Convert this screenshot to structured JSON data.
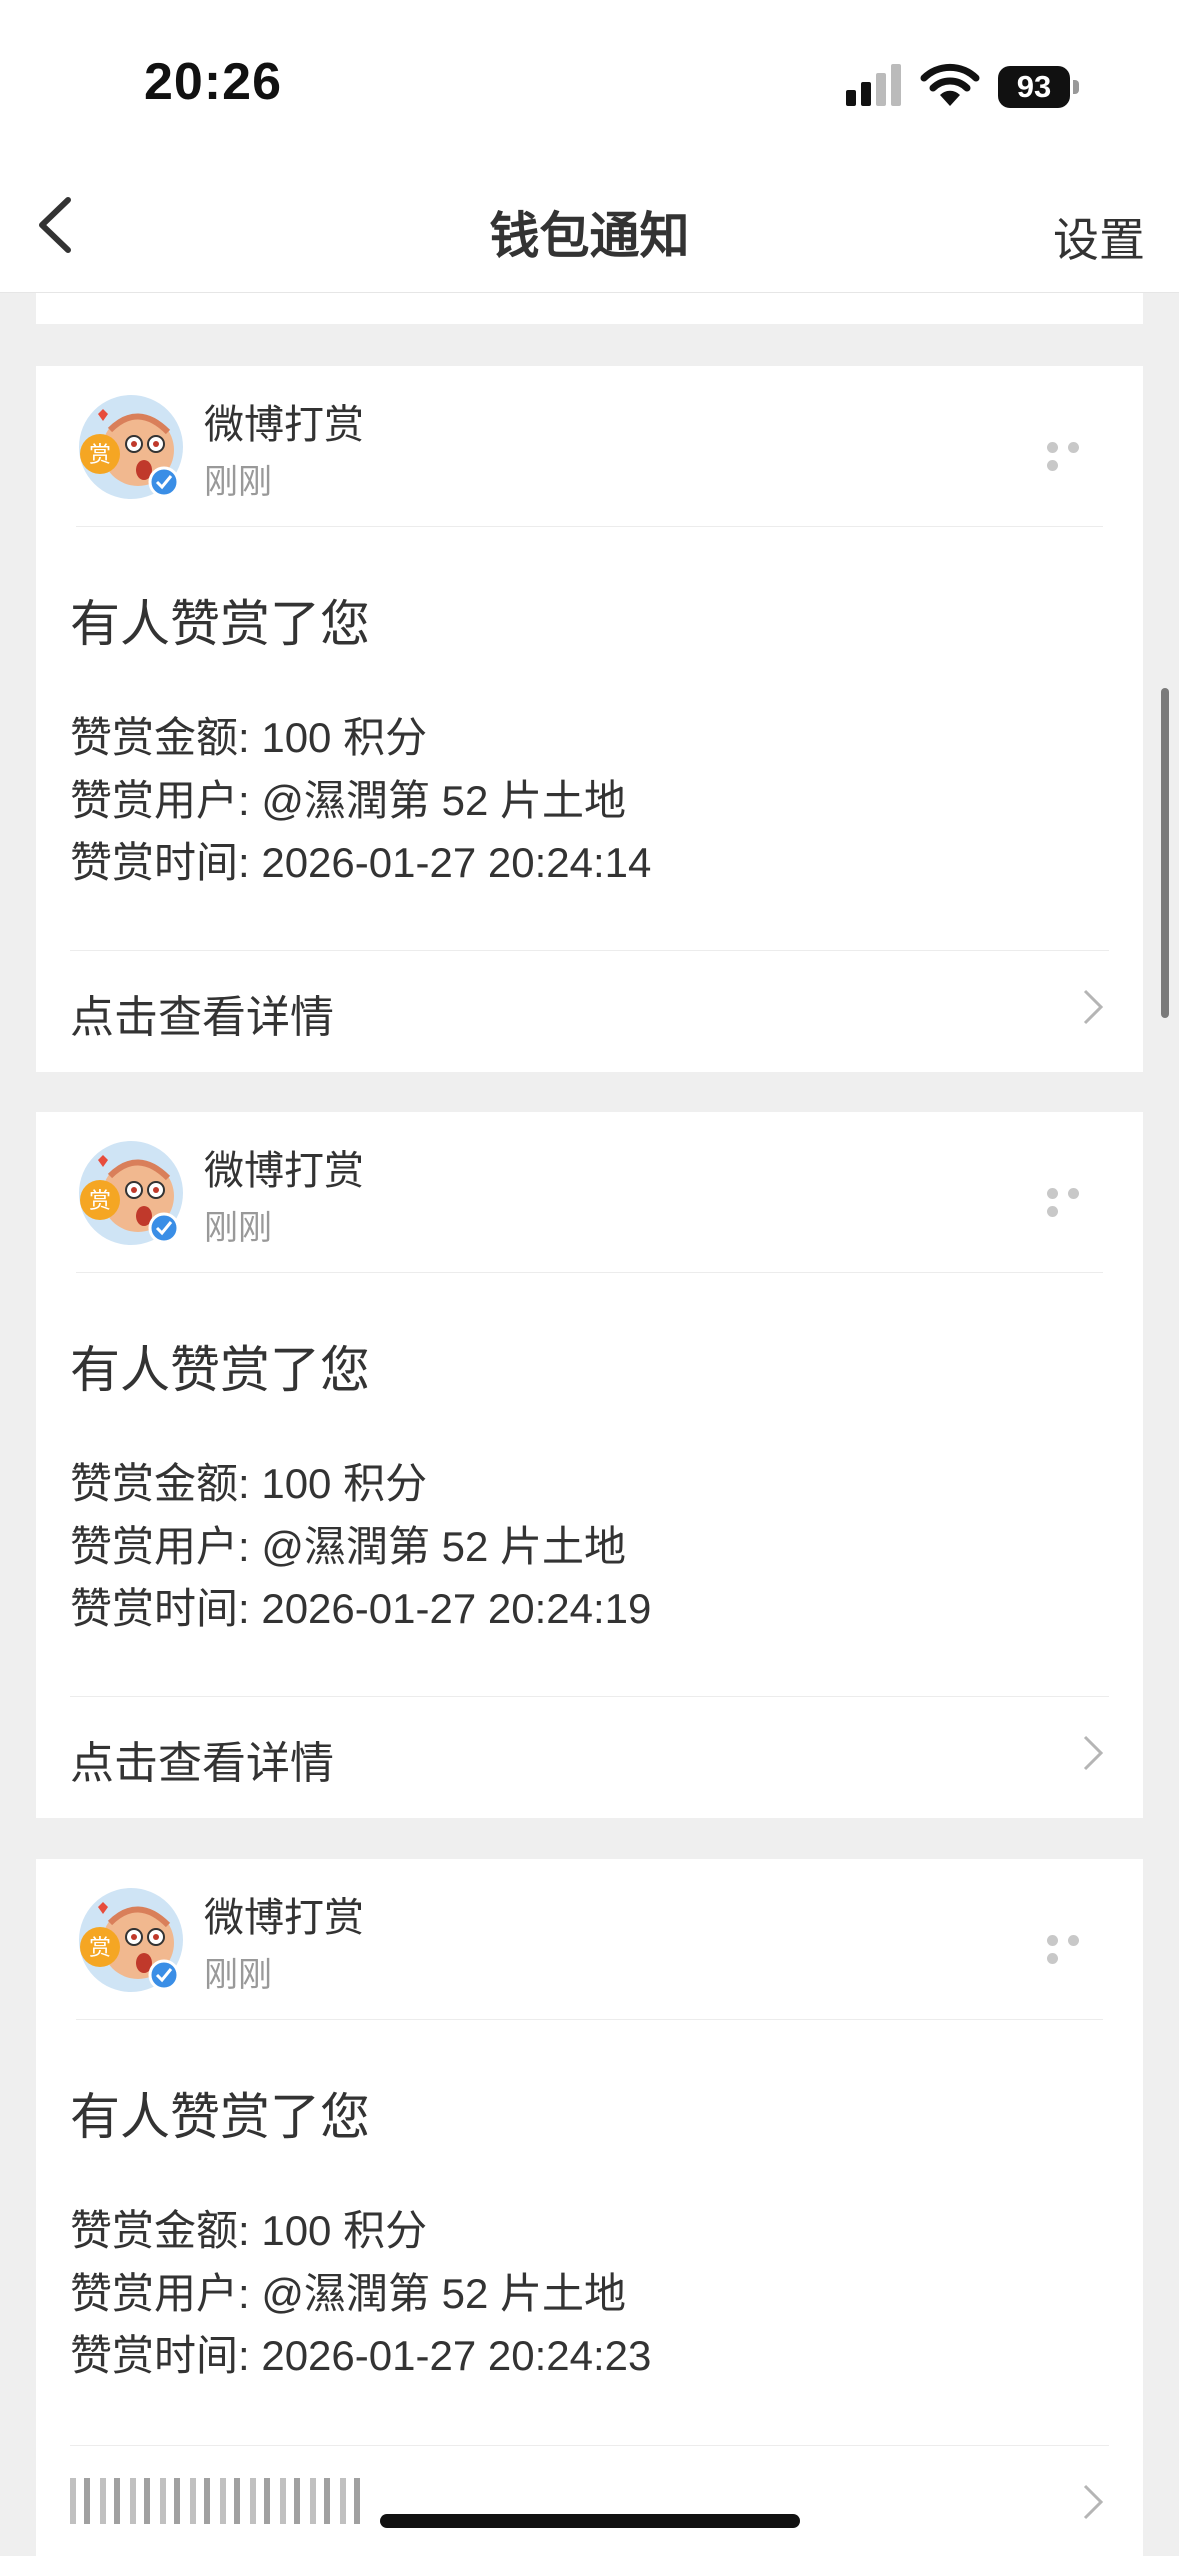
{
  "status_bar": {
    "time": "20:26",
    "battery": "93"
  },
  "nav": {
    "title": "钱包通知",
    "settings_label": "设置"
  },
  "cards": [
    {
      "sender": "微博打赏",
      "time": "刚刚",
      "title": "有人赞赏了您",
      "amount": "赞赏金额: 100 积分",
      "user": "赞赏用户: @濕潤第 52 片土地",
      "datetime": "赞赏时间: 2026-01-27 20:24:14",
      "action": "点击查看详情"
    },
    {
      "sender": "微博打赏",
      "time": "刚刚",
      "title": "有人赞赏了您",
      "amount": "赞赏金额: 100 积分",
      "user": "赞赏用户: @濕潤第 52 片土地",
      "datetime": "赞赏时间: 2026-01-27 20:24:19",
      "action": "点击查看详情"
    },
    {
      "sender": "微博打赏",
      "time": "刚刚",
      "title": "有人赞赏了您",
      "amount": "赞赏金额: 100 积分",
      "user": "赞赏用户: @濕潤第 52 片土地",
      "datetime": "赞赏时间: 2026-01-27 20:24:23",
      "action": ""
    }
  ],
  "icons": {
    "back": "chevron-left-icon",
    "more": "more-dots-icon",
    "chevron": "chevron-right-icon",
    "avatar": "reward-mascot-avatar",
    "verified": "verified-badge-icon"
  },
  "colors": {
    "background": "#efefef",
    "card": "#ffffff",
    "text": "#333333",
    "muted": "#999999",
    "verified": "#3a8ee6"
  }
}
